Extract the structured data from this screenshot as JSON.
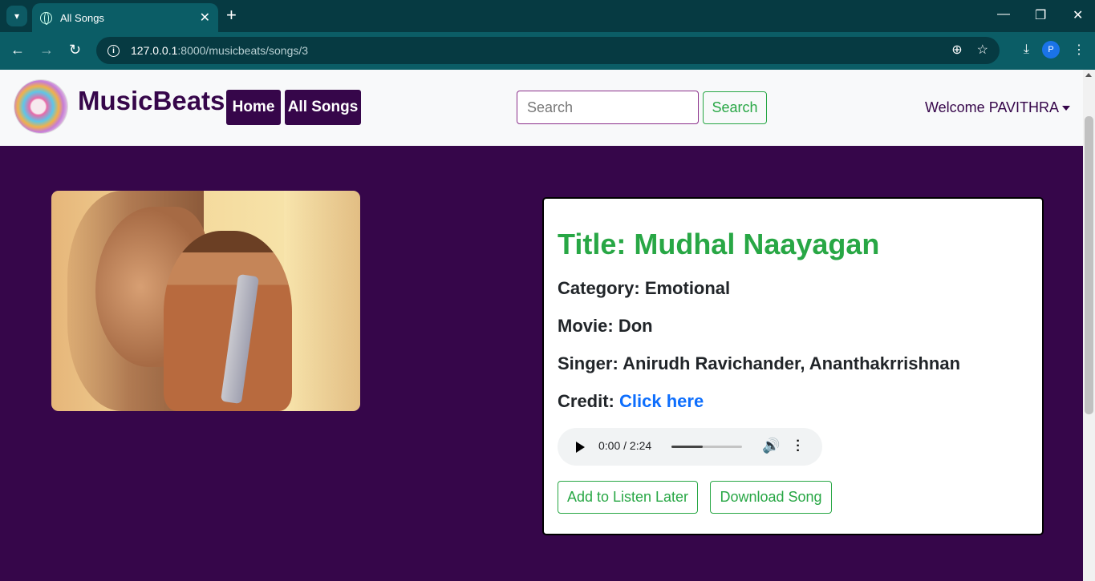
{
  "browser": {
    "tab_title": "All Songs",
    "url_host": "127.0.0.1",
    "url_path": ":8000/musicbeats/songs/3",
    "profile_initial": "P"
  },
  "navbar": {
    "brand": "MusicBeats",
    "home_label": "Home",
    "all_songs_label": "All Songs",
    "search_placeholder": "Search",
    "search_button": "Search",
    "welcome": "Welcome PAVITHRA"
  },
  "song": {
    "title": "Title: Mudhal Naayagan",
    "category_label": "Category:",
    "category": "Emotional",
    "movie_label": "Movie:",
    "movie": "Don",
    "singer_label": "Singer:",
    "singer": "Anirudh Ravichander, Ananthakrrishnan",
    "credit_label": "Credit:",
    "credit_link": "Click here"
  },
  "player": {
    "time": "0:00 / 2:24",
    "progress": 0.44
  },
  "actions": {
    "listen_later": "Add to Listen Later",
    "download": "Download Song"
  },
  "colors": {
    "brand_purple": "#36064a",
    "accent_green": "#28a745",
    "link_blue": "#0d6efd"
  }
}
